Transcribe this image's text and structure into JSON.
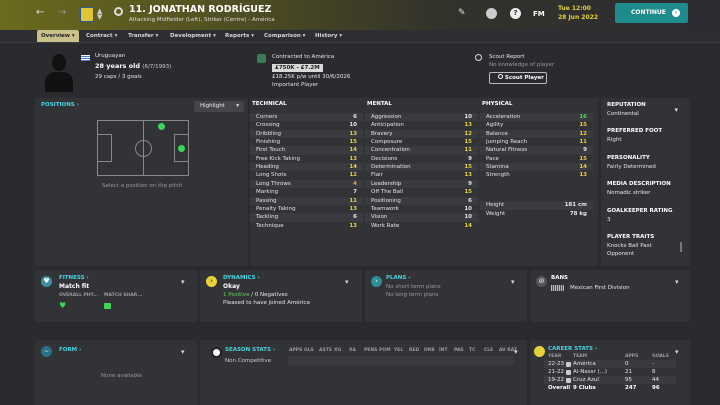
{
  "player": {
    "number_name": "11. JONATHAN RODRÍGUEZ",
    "position_club": "Attacking Midfielder (Left), Striker (Centre) - América",
    "nationality": "Uruguayan",
    "age_line": "28 years old",
    "dob": "(6/7/1993)",
    "caps": "29 caps / 3 goals"
  },
  "contract": {
    "title": "Contracted to América",
    "value": "£750K - £7.2M",
    "wage": "£18.25K p/w until 30/6/2026",
    "status": "Important Player"
  },
  "scout": {
    "title": "Scout Report",
    "text": "No knowledge of player",
    "button": "Scout Player"
  },
  "date": {
    "time": "Tue 12:00",
    "date": "28 Jun 2022"
  },
  "continue_label": "CONTINUE",
  "fm_label": "FM",
  "nav": [
    "Overview",
    "Contract",
    "Transfer",
    "Development",
    "Reports",
    "Comparison",
    "History"
  ],
  "positions": {
    "title": "POSITIONS",
    "highlight": "Highlight",
    "hint": "Select a position on the pitch"
  },
  "technical": {
    "title": "TECHNICAL",
    "rows": [
      [
        "Corners",
        "6"
      ],
      [
        "Crossing",
        "10"
      ],
      [
        "Dribbling",
        "13"
      ],
      [
        "Finishing",
        "15"
      ],
      [
        "First Touch",
        "14"
      ],
      [
        "Free Kick Taking",
        "13"
      ],
      [
        "Heading",
        "14"
      ],
      [
        "Long Shots",
        "12"
      ],
      [
        "Long Throws",
        "4"
      ],
      [
        "Marking",
        "7"
      ],
      [
        "Passing",
        "11"
      ],
      [
        "Penalty Taking",
        "13"
      ],
      [
        "Tackling",
        "6"
      ],
      [
        "Technique",
        "13"
      ]
    ]
  },
  "mental": {
    "title": "MENTAL",
    "rows": [
      [
        "Aggression",
        "10"
      ],
      [
        "Anticipation",
        "13"
      ],
      [
        "Bravery",
        "12"
      ],
      [
        "Composure",
        "15"
      ],
      [
        "Concentration",
        "11"
      ],
      [
        "Decisions",
        "9"
      ],
      [
        "Determination",
        "15"
      ],
      [
        "Flair",
        "13"
      ],
      [
        "Leadership",
        "9"
      ],
      [
        "Off The Ball",
        "15"
      ],
      [
        "Positioning",
        "6"
      ],
      [
        "Teamwork",
        "10"
      ],
      [
        "Vision",
        "10"
      ],
      [
        "Work Rate",
        "14"
      ]
    ]
  },
  "physical": {
    "title": "PHYSICAL",
    "rows": [
      [
        "Acceleration",
        "16"
      ],
      [
        "Agility",
        "15"
      ],
      [
        "Balance",
        "12"
      ],
      [
        "Jumping Reach",
        "11"
      ],
      [
        "Natural Fitness",
        "9"
      ],
      [
        "Pace",
        "15"
      ],
      [
        "Stamina",
        "14"
      ],
      [
        "Strength",
        "13"
      ]
    ],
    "height_label": "Height",
    "height": "181 cm",
    "weight_label": "Weight",
    "weight": "78 kg"
  },
  "side": {
    "reputation_t": "REPUTATION",
    "reputation": "Continental",
    "foot_t": "PREFERRED FOOT",
    "foot": "Right",
    "personality_t": "PERSONALITY",
    "personality": "Fairly Determined",
    "media_t": "MEDIA DESCRIPTION",
    "media": "Nomadic striker",
    "gk_t": "GOALKEEPER RATING",
    "gk": "3",
    "traits_t": "PLAYER TRAITS",
    "traits": "Knocks Ball Past Opponent"
  },
  "fitness": {
    "title": "FITNESS",
    "status": "Match fit",
    "col1": "OVERALL PHY...",
    "col2": "MATCH SHAR..."
  },
  "dynamics": {
    "title": "DYNAMICS",
    "status": "Okay",
    "pos": "1 Positive",
    "sep": " / ",
    "neg": "0 Negatives",
    "note": "Pleased to have joined América"
  },
  "plans": {
    "title": "PLANS",
    "short": "No short term plans",
    "long": "No long term plans"
  },
  "bans": {
    "title": "BANS",
    "text": "Mexican First Division"
  },
  "form": {
    "title": "FORM",
    "none": "None available"
  },
  "season": {
    "title": "SEASON STATS",
    "cols": [
      "APPS",
      "GLS",
      "ASTS",
      "XG",
      "XA",
      "PENS",
      "POM",
      "YEL",
      "RED",
      "DRB",
      "INT",
      "PAS",
      "TC",
      "CLE",
      "AV RAT"
    ],
    "row_label": "Non Competitive"
  },
  "career": {
    "title": "CAREER STATS",
    "cols": [
      "YEAR",
      "TEAM",
      "APPS",
      "GOALS"
    ],
    "rows": [
      [
        "22-23",
        "América",
        "0",
        "-"
      ],
      [
        "21-22",
        "Al-Nassr (...)",
        "21",
        "8"
      ],
      [
        "19-22",
        "Cruz Azul",
        "95",
        "44"
      ]
    ],
    "overall": "Overall",
    "clubs": "9 Clubs",
    "tot_apps": "247",
    "tot_goals": "96"
  }
}
